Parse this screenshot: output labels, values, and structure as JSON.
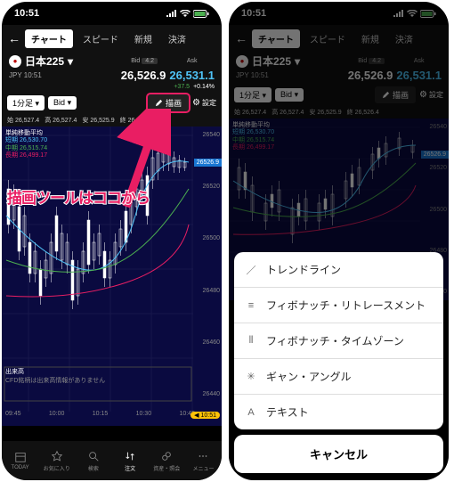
{
  "status": {
    "time": "10:51"
  },
  "nav": {
    "tabs": [
      "チャート",
      "スピード",
      "新規",
      "決済"
    ],
    "active": 0
  },
  "instrument": {
    "name": "日本225",
    "sub": "JPY 10:51",
    "bid_label": "Bid",
    "ask_label": "Ask",
    "spread": "4.2",
    "bid": "26,526.9",
    "ask": "26,531.1",
    "change_abs": "+37.5",
    "change_pct": "+0.14%"
  },
  "toolbar": {
    "timeframe": "1分足",
    "bidask": "Bid",
    "draw_label": "描画",
    "settings_label": "設定"
  },
  "ohlc": {
    "open_l": "始",
    "open": "26,527.4",
    "high_l": "高",
    "high": "26,527.4",
    "low_l": "安",
    "low": "26,525.9",
    "close_l": "終",
    "close": "26,526.4"
  },
  "ma": {
    "title": "単純移動平均",
    "l1_label": "短期",
    "l1_val": "26,530.70",
    "l2_label": "中期",
    "l2_val": "26,515.74",
    "l3_label": "長期",
    "l3_val": "26,499.17"
  },
  "chart_data": {
    "type": "candlestick",
    "ylim": [
      26440,
      26540
    ],
    "yticks": [
      26540.0,
      26520.0,
      26500.0,
      26480.0,
      26460.0,
      26440.0
    ],
    "price_tag": "26526.9",
    "xticks": [
      "09:45",
      "10:00",
      "10:15",
      "10:30",
      "10:45"
    ],
    "time_tag": "10:51"
  },
  "volume": {
    "title": "出来高",
    "msg": "CFD銘柄は出来高情報がありません"
  },
  "callout": "描画ツールはココから",
  "tabbar": [
    "TODAY",
    "お気に入り",
    "検索",
    "注文",
    "資産・照会",
    "メニュー"
  ],
  "tabbar_active": 3,
  "sheet": {
    "items": [
      {
        "icon": "line",
        "label": "トレンドライン"
      },
      {
        "icon": "fibr",
        "label": "フィボナッチ・リトレースメント"
      },
      {
        "icon": "fibt",
        "label": "フィボナッチ・タイムゾーン"
      },
      {
        "icon": "gann",
        "label": "ギャン・アングル"
      },
      {
        "icon": "text",
        "label": "テキスト"
      }
    ],
    "cancel": "キャンセル"
  }
}
